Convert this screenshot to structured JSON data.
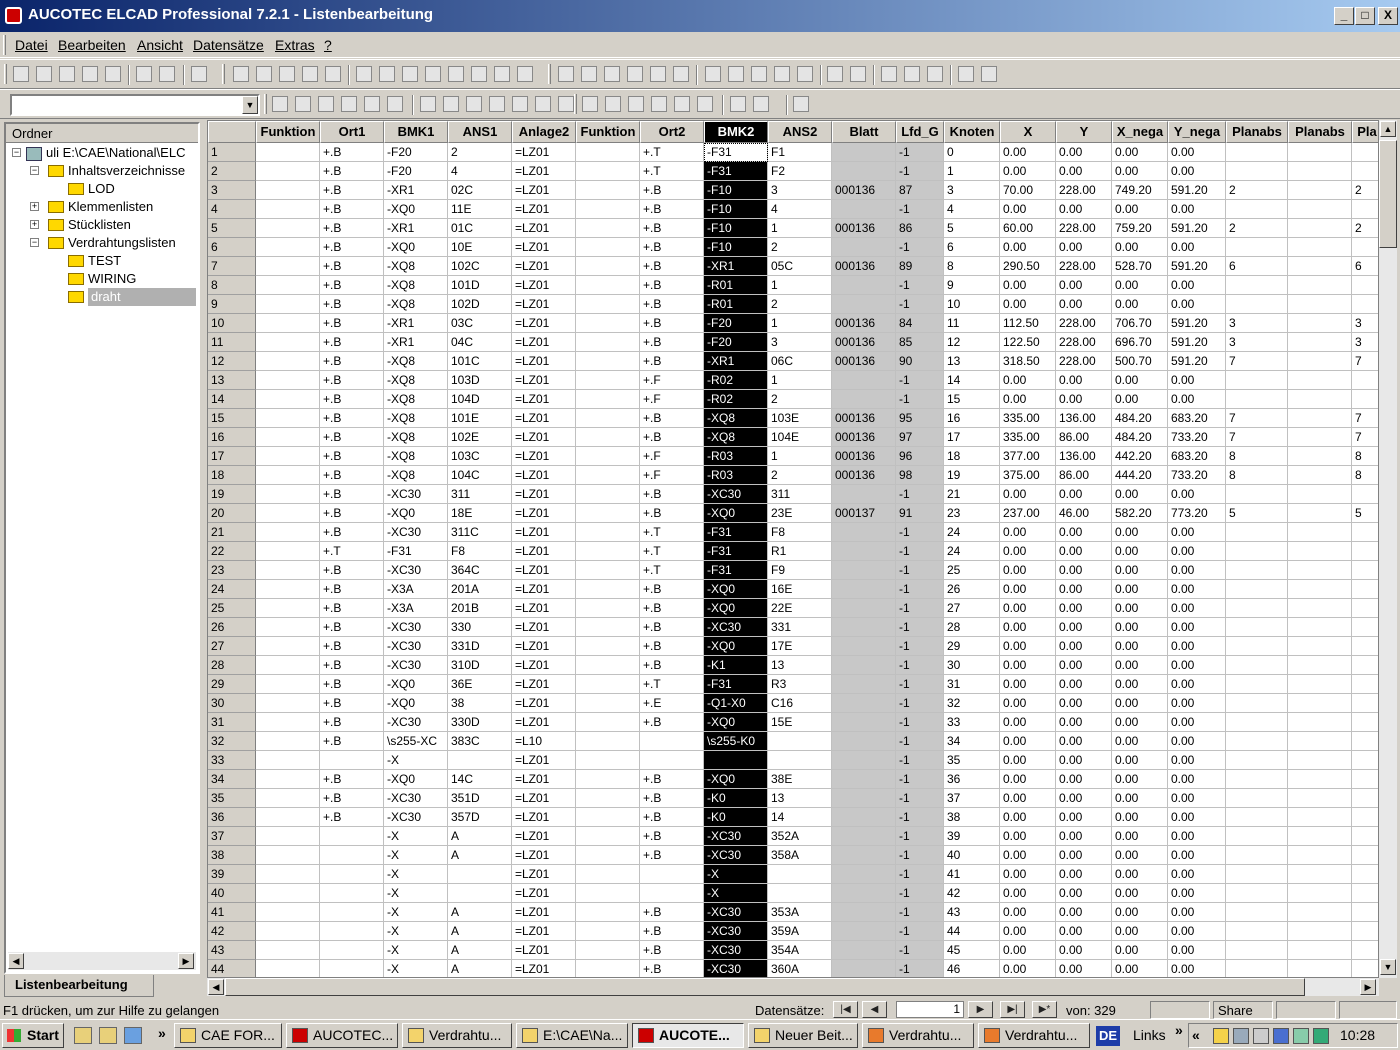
{
  "window": {
    "title": "AUCOTEC ELCAD Professional 7.2.1 - Listenbearbeitung",
    "min": "_",
    "max": "□",
    "close": "X"
  },
  "menu": [
    "Datei",
    "Bearbeiten",
    "Ansicht",
    "Datensätze",
    "Extras",
    "?"
  ],
  "combo": {
    "value": ""
  },
  "folders": {
    "header": "Ordner",
    "nodes": [
      {
        "label": "uli E:\\CAE\\National\\ELC",
        "level": 0,
        "exp": "−",
        "icon": "pc"
      },
      {
        "label": "Inhaltsverzeichnisse",
        "level": 1,
        "exp": "−",
        "icon": "folder"
      },
      {
        "label": "LOD",
        "level": 2,
        "exp": "",
        "icon": "folder"
      },
      {
        "label": "Klemmenlisten",
        "level": 1,
        "exp": "+",
        "icon": "folder"
      },
      {
        "label": "Stücklisten",
        "level": 1,
        "exp": "+",
        "icon": "folder"
      },
      {
        "label": "Verdrahtungslisten",
        "level": 1,
        "exp": "−",
        "icon": "folder"
      },
      {
        "label": "TEST",
        "level": 2,
        "exp": "",
        "icon": "folder"
      },
      {
        "label": "WIRING",
        "level": 2,
        "exp": "",
        "icon": "folder"
      },
      {
        "label": "draht",
        "level": 2,
        "exp": "",
        "icon": "folder",
        "selected": true
      }
    ]
  },
  "bottom_tab": "Listenbearbeitung",
  "grid": {
    "columns": [
      "Funktion",
      "Ort1",
      "BMK1",
      "ANS1",
      "Anlage2",
      "Funktion",
      "Ort2",
      "BMK2",
      "ANS2",
      "Blatt",
      "Lfd_G",
      "Knoten",
      "X",
      "Y",
      "X_nega",
      "Y_nega",
      "Planabs",
      "Planabs",
      "Pla"
    ],
    "rows": [
      [
        "",
        "+.B",
        "-F20",
        "2",
        "=LZ01",
        "",
        "+.T",
        "-F31",
        "F1",
        "",
        "-1",
        "0",
        "0.00",
        "0.00",
        "0.00",
        "0.00",
        "",
        "",
        ""
      ],
      [
        "",
        "+.B",
        "-F20",
        "4",
        "=LZ01",
        "",
        "+.T",
        "-F31",
        "F2",
        "",
        "-1",
        "1",
        "0.00",
        "0.00",
        "0.00",
        "0.00",
        "",
        "",
        ""
      ],
      [
        "",
        "+.B",
        "-XR1",
        "02C",
        "=LZ01",
        "",
        "+.B",
        "-F10",
        "3",
        "000136",
        "87",
        "3",
        "70.00",
        "228.00",
        "749.20",
        "591.20",
        "2",
        "",
        "2"
      ],
      [
        "",
        "+.B",
        "-XQ0",
        "11E",
        "=LZ01",
        "",
        "+.B",
        "-F10",
        "4",
        "",
        "-1",
        "4",
        "0.00",
        "0.00",
        "0.00",
        "0.00",
        "",
        "",
        ""
      ],
      [
        "",
        "+.B",
        "-XR1",
        "01C",
        "=LZ01",
        "",
        "+.B",
        "-F10",
        "1",
        "000136",
        "86",
        "5",
        "60.00",
        "228.00",
        "759.20",
        "591.20",
        "2",
        "",
        "2"
      ],
      [
        "",
        "+.B",
        "-XQ0",
        "10E",
        "=LZ01",
        "",
        "+.B",
        "-F10",
        "2",
        "",
        "-1",
        "6",
        "0.00",
        "0.00",
        "0.00",
        "0.00",
        "",
        "",
        ""
      ],
      [
        "",
        "+.B",
        "-XQ8",
        "102C",
        "=LZ01",
        "",
        "+.B",
        "-XR1",
        "05C",
        "000136",
        "89",
        "8",
        "290.50",
        "228.00",
        "528.70",
        "591.20",
        "6",
        "",
        "6"
      ],
      [
        "",
        "+.B",
        "-XQ8",
        "101D",
        "=LZ01",
        "",
        "+.B",
        "-R01",
        "1",
        "",
        "-1",
        "9",
        "0.00",
        "0.00",
        "0.00",
        "0.00",
        "",
        "",
        ""
      ],
      [
        "",
        "+.B",
        "-XQ8",
        "102D",
        "=LZ01",
        "",
        "+.B",
        "-R01",
        "2",
        "",
        "-1",
        "10",
        "0.00",
        "0.00",
        "0.00",
        "0.00",
        "",
        "",
        ""
      ],
      [
        "",
        "+.B",
        "-XR1",
        "03C",
        "=LZ01",
        "",
        "+.B",
        "-F20",
        "1",
        "000136",
        "84",
        "11",
        "112.50",
        "228.00",
        "706.70",
        "591.20",
        "3",
        "",
        "3"
      ],
      [
        "",
        "+.B",
        "-XR1",
        "04C",
        "=LZ01",
        "",
        "+.B",
        "-F20",
        "3",
        "000136",
        "85",
        "12",
        "122.50",
        "228.00",
        "696.70",
        "591.20",
        "3",
        "",
        "3"
      ],
      [
        "",
        "+.B",
        "-XQ8",
        "101C",
        "=LZ01",
        "",
        "+.B",
        "-XR1",
        "06C",
        "000136",
        "90",
        "13",
        "318.50",
        "228.00",
        "500.70",
        "591.20",
        "7",
        "",
        "7"
      ],
      [
        "",
        "+.B",
        "-XQ8",
        "103D",
        "=LZ01",
        "",
        "+.F",
        "-R02",
        "1",
        "",
        "-1",
        "14",
        "0.00",
        "0.00",
        "0.00",
        "0.00",
        "",
        "",
        ""
      ],
      [
        "",
        "+.B",
        "-XQ8",
        "104D",
        "=LZ01",
        "",
        "+.F",
        "-R02",
        "2",
        "",
        "-1",
        "15",
        "0.00",
        "0.00",
        "0.00",
        "0.00",
        "",
        "",
        ""
      ],
      [
        "",
        "+.B",
        "-XQ8",
        "101E",
        "=LZ01",
        "",
        "+.B",
        "-XQ8",
        "103E",
        "000136",
        "95",
        "16",
        "335.00",
        "136.00",
        "484.20",
        "683.20",
        "7",
        "",
        "7"
      ],
      [
        "",
        "+.B",
        "-XQ8",
        "102E",
        "=LZ01",
        "",
        "+.B",
        "-XQ8",
        "104E",
        "000136",
        "97",
        "17",
        "335.00",
        "86.00",
        "484.20",
        "733.20",
        "7",
        "",
        "7"
      ],
      [
        "",
        "+.B",
        "-XQ8",
        "103C",
        "=LZ01",
        "",
        "+.F",
        "-R03",
        "1",
        "000136",
        "96",
        "18",
        "377.00",
        "136.00",
        "442.20",
        "683.20",
        "8",
        "",
        "8"
      ],
      [
        "",
        "+.B",
        "-XQ8",
        "104C",
        "=LZ01",
        "",
        "+.F",
        "-R03",
        "2",
        "000136",
        "98",
        "19",
        "375.00",
        "86.00",
        "444.20",
        "733.20",
        "8",
        "",
        "8"
      ],
      [
        "",
        "+.B",
        "-XC30",
        "311",
        "=LZ01",
        "",
        "+.B",
        "-XC30",
        "311",
        "",
        "-1",
        "21",
        "0.00",
        "0.00",
        "0.00",
        "0.00",
        "",
        "",
        ""
      ],
      [
        "",
        "+.B",
        "-XQ0",
        "18E",
        "=LZ01",
        "",
        "+.B",
        "-XQ0",
        "23E",
        "000137",
        "91",
        "23",
        "237.00",
        "46.00",
        "582.20",
        "773.20",
        "5",
        "",
        "5"
      ],
      [
        "",
        "+.B",
        "-XC30",
        "311C",
        "=LZ01",
        "",
        "+.T",
        "-F31",
        "F8",
        "",
        "-1",
        "24",
        "0.00",
        "0.00",
        "0.00",
        "0.00",
        "",
        "",
        ""
      ],
      [
        "",
        "+.T",
        "-F31",
        "F8",
        "=LZ01",
        "",
        "+.T",
        "-F31",
        "R1",
        "",
        "-1",
        "24",
        "0.00",
        "0.00",
        "0.00",
        "0.00",
        "",
        "",
        ""
      ],
      [
        "",
        "+.B",
        "-XC30",
        "364C",
        "=LZ01",
        "",
        "+.T",
        "-F31",
        "F9",
        "",
        "-1",
        "25",
        "0.00",
        "0.00",
        "0.00",
        "0.00",
        "",
        "",
        ""
      ],
      [
        "",
        "+.B",
        "-X3A",
        "201A",
        "=LZ01",
        "",
        "+.B",
        "-XQ0",
        "16E",
        "",
        "-1",
        "26",
        "0.00",
        "0.00",
        "0.00",
        "0.00",
        "",
        "",
        ""
      ],
      [
        "",
        "+.B",
        "-X3A",
        "201B",
        "=LZ01",
        "",
        "+.B",
        "-XQ0",
        "22E",
        "",
        "-1",
        "27",
        "0.00",
        "0.00",
        "0.00",
        "0.00",
        "",
        "",
        ""
      ],
      [
        "",
        "+.B",
        "-XC30",
        "330",
        "=LZ01",
        "",
        "+.B",
        "-XC30",
        "331",
        "",
        "-1",
        "28",
        "0.00",
        "0.00",
        "0.00",
        "0.00",
        "",
        "",
        ""
      ],
      [
        "",
        "+.B",
        "-XC30",
        "331D",
        "=LZ01",
        "",
        "+.B",
        "-XQ0",
        "17E",
        "",
        "-1",
        "29",
        "0.00",
        "0.00",
        "0.00",
        "0.00",
        "",
        "",
        ""
      ],
      [
        "",
        "+.B",
        "-XC30",
        "310D",
        "=LZ01",
        "",
        "+.B",
        "-K1",
        "13",
        "",
        "-1",
        "30",
        "0.00",
        "0.00",
        "0.00",
        "0.00",
        "",
        "",
        ""
      ],
      [
        "",
        "+.B",
        "-XQ0",
        "36E",
        "=LZ01",
        "",
        "+.T",
        "-F31",
        "R3",
        "",
        "-1",
        "31",
        "0.00",
        "0.00",
        "0.00",
        "0.00",
        "",
        "",
        ""
      ],
      [
        "",
        "+.B",
        "-XQ0",
        "38",
        "=LZ01",
        "",
        "+.E",
        "-Q1-X0",
        "C16",
        "",
        "-1",
        "32",
        "0.00",
        "0.00",
        "0.00",
        "0.00",
        "",
        "",
        ""
      ],
      [
        "",
        "+.B",
        "-XC30",
        "330D",
        "=LZ01",
        "",
        "+.B",
        "-XQ0",
        "15E",
        "",
        "-1",
        "33",
        "0.00",
        "0.00",
        "0.00",
        "0.00",
        "",
        "",
        ""
      ],
      [
        "",
        "+.B",
        "\\s255-XC",
        "383C",
        "=L10",
        "",
        "",
        "\\s255-K0",
        "",
        "",
        "-1",
        "34",
        "0.00",
        "0.00",
        "0.00",
        "0.00",
        "",
        "",
        ""
      ],
      [
        "",
        "",
        "-X",
        "",
        "=LZ01",
        "",
        "",
        "",
        "",
        "",
        "-1",
        "35",
        "0.00",
        "0.00",
        "0.00",
        "0.00",
        "",
        "",
        ""
      ],
      [
        "",
        "+.B",
        "-XQ0",
        "14C",
        "=LZ01",
        "",
        "+.B",
        "-XQ0",
        "38E",
        "",
        "-1",
        "36",
        "0.00",
        "0.00",
        "0.00",
        "0.00",
        "",
        "",
        ""
      ],
      [
        "",
        "+.B",
        "-XC30",
        "351D",
        "=LZ01",
        "",
        "+.B",
        "-K0",
        "13",
        "",
        "-1",
        "37",
        "0.00",
        "0.00",
        "0.00",
        "0.00",
        "",
        "",
        ""
      ],
      [
        "",
        "+.B",
        "-XC30",
        "357D",
        "=LZ01",
        "",
        "+.B",
        "-K0",
        "14",
        "",
        "-1",
        "38",
        "0.00",
        "0.00",
        "0.00",
        "0.00",
        "",
        "",
        ""
      ],
      [
        "",
        "",
        "-X",
        "A",
        "=LZ01",
        "",
        "+.B",
        "-XC30",
        "352A",
        "",
        "-1",
        "39",
        "0.00",
        "0.00",
        "0.00",
        "0.00",
        "",
        "",
        ""
      ],
      [
        "",
        "",
        "-X",
        "A",
        "=LZ01",
        "",
        "+.B",
        "-XC30",
        "358A",
        "",
        "-1",
        "40",
        "0.00",
        "0.00",
        "0.00",
        "0.00",
        "",
        "",
        ""
      ],
      [
        "",
        "",
        "-X",
        "",
        "=LZ01",
        "",
        "",
        "-X",
        "",
        "",
        "-1",
        "41",
        "0.00",
        "0.00",
        "0.00",
        "0.00",
        "",
        "",
        ""
      ],
      [
        "",
        "",
        "-X",
        "",
        "=LZ01",
        "",
        "",
        "-X",
        "",
        "",
        "-1",
        "42",
        "0.00",
        "0.00",
        "0.00",
        "0.00",
        "",
        "",
        ""
      ],
      [
        "",
        "",
        "-X",
        "A",
        "=LZ01",
        "",
        "+.B",
        "-XC30",
        "353A",
        "",
        "-1",
        "43",
        "0.00",
        "0.00",
        "0.00",
        "0.00",
        "",
        "",
        ""
      ],
      [
        "",
        "",
        "-X",
        "A",
        "=LZ01",
        "",
        "+.B",
        "-XC30",
        "359A",
        "",
        "-1",
        "44",
        "0.00",
        "0.00",
        "0.00",
        "0.00",
        "",
        "",
        ""
      ],
      [
        "",
        "",
        "-X",
        "A",
        "=LZ01",
        "",
        "+.B",
        "-XC30",
        "354A",
        "",
        "-1",
        "45",
        "0.00",
        "0.00",
        "0.00",
        "0.00",
        "",
        "",
        ""
      ],
      [
        "",
        "",
        "-X",
        "A",
        "=LZ01",
        "",
        "+.B",
        "-XC30",
        "360A",
        "",
        "-1",
        "46",
        "0.00",
        "0.00",
        "0.00",
        "0.00",
        "",
        "",
        ""
      ]
    ]
  },
  "status": {
    "help": "F1 drücken, um zur Hilfe zu gelangen",
    "datensatz_label": "Datensätze:",
    "record": "1",
    "total": "von: 329",
    "share": "Share"
  },
  "taskbar": {
    "start": "Start",
    "more": "»",
    "tasks": [
      "CAE FOR...",
      "AUCOTEC...",
      "Verdrahtu...",
      "E:\\CAE\\Na...",
      "AUCOTE...",
      "Neuer Beit...",
      "Verdrahtu...",
      "Verdrahtu..."
    ],
    "lang": "DE",
    "links": "Links",
    "links_more": "»",
    "tray_more": "«",
    "clock": "10:28"
  }
}
